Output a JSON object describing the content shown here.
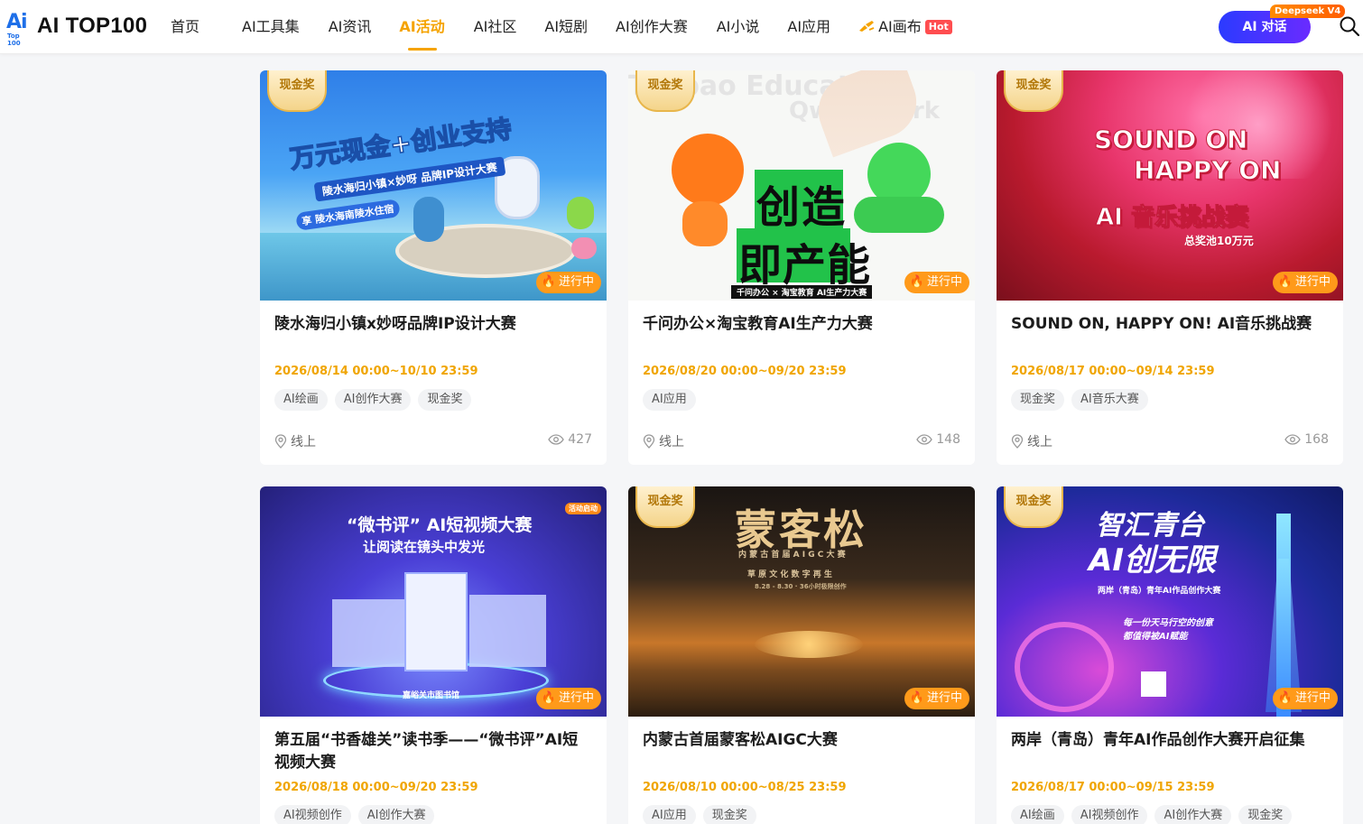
{
  "header": {
    "logo_mark": "Ai",
    "logo_mark_sub": "Top 100",
    "logo_text": "AI TOP100",
    "nav": [
      {
        "label": "首页",
        "active": false
      },
      {
        "label": "AI工具集",
        "active": false
      },
      {
        "label": "AI资讯",
        "active": false
      },
      {
        "label": "AI活动",
        "active": true
      },
      {
        "label": "AI社区",
        "active": false
      },
      {
        "label": "AI短剧",
        "active": false
      },
      {
        "label": "AI创作大赛",
        "active": false
      },
      {
        "label": "AI小说",
        "active": false
      },
      {
        "label": "AI应用",
        "active": false
      },
      {
        "label": "AI画布",
        "active": false,
        "badge": "Hot"
      }
    ],
    "chat_button": "AI 对话",
    "chat_badge": "Deepseek V4"
  },
  "cards": [
    {
      "ribbon": "现金奖",
      "status": "进行中",
      "title": "陵水海归小镇x妙呀品牌IP设计大赛",
      "date": "2026/08/14 00:00~10/10 23:59",
      "tags": [
        "AI绘画",
        "AI创作大赛",
        "现金奖"
      ],
      "location": "线上",
      "views": "427",
      "art": {
        "line1": "万元现金+创业支持",
        "line2": "陵水海归小镇×妙呀 品牌IP设计大赛",
        "line3": "享 陵水海南陵水住宿"
      }
    },
    {
      "ribbon": "现金奖",
      "status": "进行中",
      "title": "千问办公×淘宝教育AI生产力大赛",
      "date": "2026/08/20 00:00~09/20 23:59",
      "tags": [
        "AI应用"
      ],
      "location": "线上",
      "views": "148",
      "art": {
        "line1": "创造",
        "line2": "即产能",
        "line3": "千问办公 × 淘宝教育 AI生产力大赛",
        "bg1": "Taobao Education",
        "bg2": "Qwen Work"
      }
    },
    {
      "ribbon": "现金奖",
      "status": "进行中",
      "title": "SOUND ON, HAPPY ON! AI音乐挑战赛",
      "date": "2026/08/17 00:00~09/14 23:59",
      "tags": [
        "现金奖",
        "AI音乐大赛"
      ],
      "location": "线上",
      "views": "168",
      "art": {
        "line1": "SOUND ON",
        "line2": "HAPPY ON",
        "line3": "AI 音乐挑战赛",
        "line4": "总奖池10万元"
      }
    },
    {
      "ribbon": "",
      "status": "进行中",
      "title": "第五届“书香雄关”读书季——“微书评”AI短视频大赛",
      "date": "2026/08/18 00:00~09/20 23:59",
      "tags": [
        "AI视频创作",
        "AI创作大赛"
      ],
      "location": "",
      "views": "",
      "art": {
        "line1": "“微书评” AI短视频大赛",
        "line2": "让阅读在镜头中发光",
        "line3": "嘉峪关市图书馆",
        "corner": "活动启动"
      }
    },
    {
      "ribbon": "现金奖",
      "status": "进行中",
      "title": "内蒙古首届蒙客松AIGC大赛",
      "date": "2026/08/10 00:00~08/25 23:59",
      "tags": [
        "AI应用",
        "现金奖"
      ],
      "location": "",
      "views": "",
      "art": {
        "line1": "蒙客松",
        "line2": "内 蒙 古 首 届 A I G C 大 赛",
        "line3": "草 原 文 化 数 字 再 生",
        "line4": "8.28 - 8.30 · 36小时极限创作"
      }
    },
    {
      "ribbon": "现金奖",
      "status": "进行中",
      "title": "两岸（青岛）青年AI作品创作大赛开启征集",
      "date": "2026/08/17 00:00~09/15 23:59",
      "tags": [
        "AI绘画",
        "AI视频创作",
        "AI创作大赛",
        "现金奖"
      ],
      "location": "",
      "views": "",
      "art": {
        "line1": "智汇青台",
        "line2": "AI创无限",
        "line3": "两岸（青岛）青年AI作品创作大赛",
        "line4": "每一份天马行空的创意 都值得被AI赋能"
      }
    }
  ],
  "colors": {
    "accent": "#f5a300",
    "hot": "#ff4d4f",
    "status": "#ff9a1a",
    "date": "#f0a500"
  }
}
